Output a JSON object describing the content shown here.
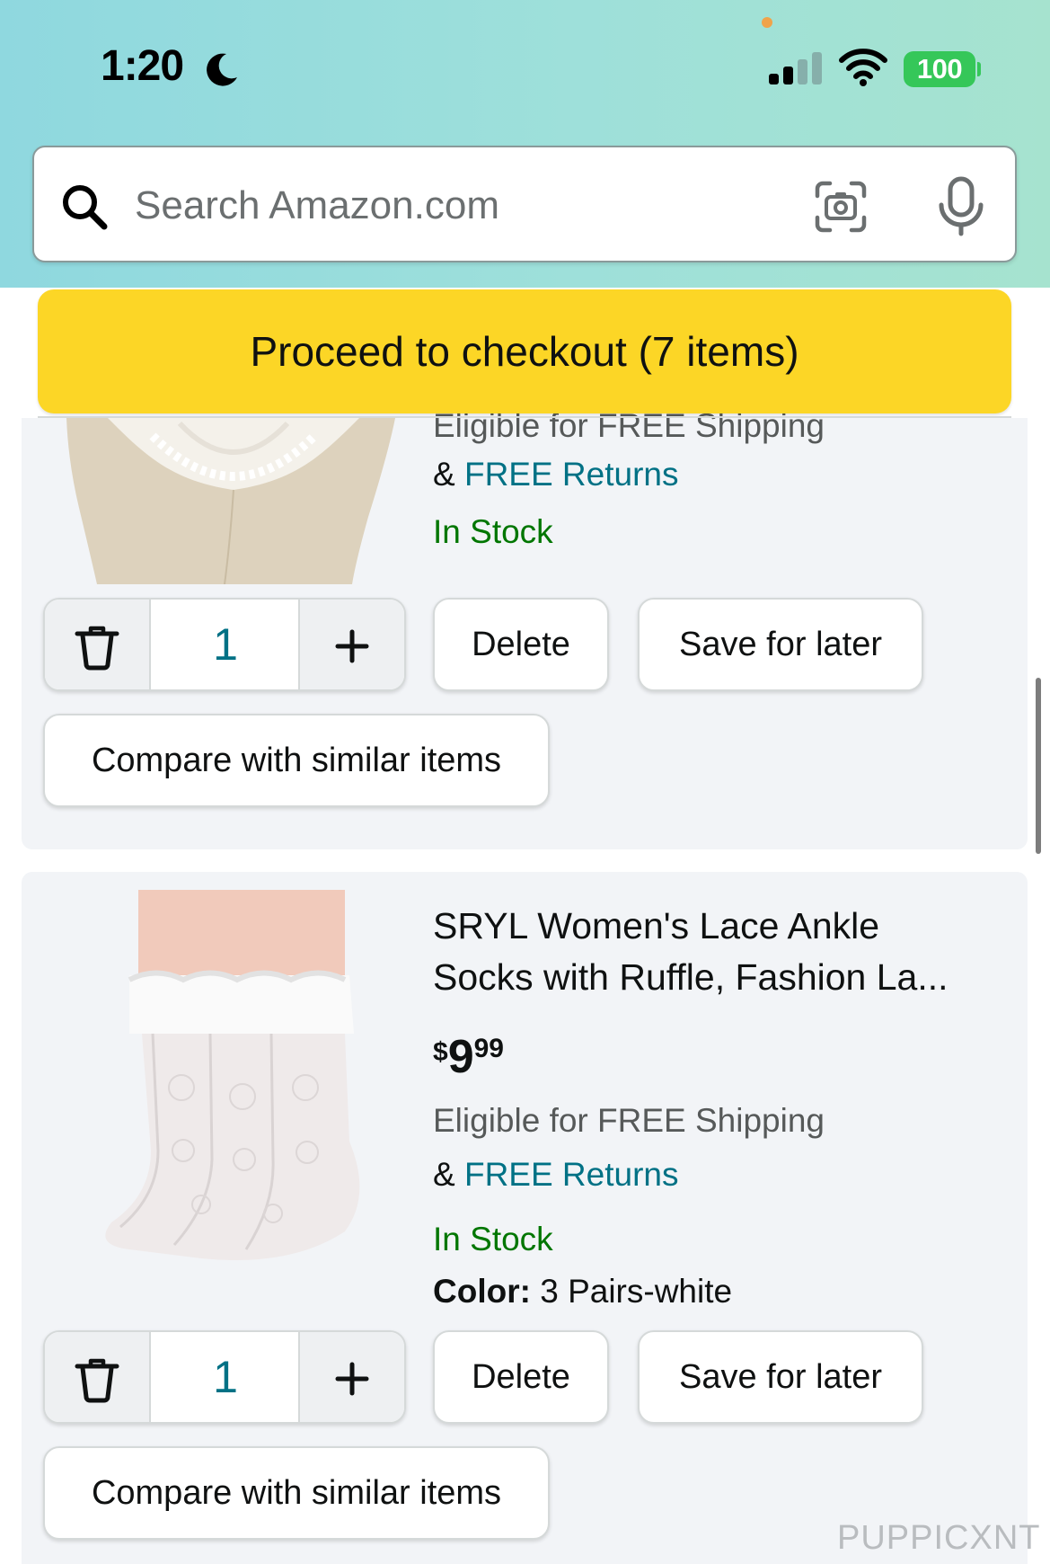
{
  "status_bar": {
    "time": "1:20",
    "battery": "100",
    "icons": [
      "moon-icon",
      "signal-icon",
      "wifi-icon",
      "battery-icon"
    ]
  },
  "search": {
    "placeholder": "Search Amazon.com",
    "value": "",
    "icons": [
      "search-icon",
      "camera-icon",
      "mic-icon"
    ]
  },
  "checkout": {
    "label": "Proceed to checkout (7 items)"
  },
  "items": [
    {
      "shipping": "Eligible for FREE Shipping",
      "returns_prefix": "&",
      "returns_link": "FREE Returns",
      "stock": "In Stock",
      "quantity": "1",
      "delete_label": "Delete",
      "save_label": "Save for later",
      "compare_label": "Compare with similar items"
    },
    {
      "title_line1": "SRYL Women's Lace Ankle",
      "title_line2": "Socks with Ruffle, Fashion La...",
      "price_symbol": "$",
      "price_whole": "9",
      "price_fraction": "99",
      "shipping": "Eligible for FREE Shipping",
      "returns_prefix": "&",
      "returns_link": "FREE Returns",
      "stock": "In Stock",
      "color_label": "Color:",
      "color_value": "3 Pairs-white",
      "quantity": "1",
      "delete_label": "Delete",
      "save_label": "Save for later",
      "compare_label": "Compare with similar items"
    }
  ],
  "watermark": "PUPPICXNT",
  "colors": {
    "checkout_yellow": "#fcd626",
    "link_teal": "#007185",
    "stock_green": "#007600",
    "battery_green": "#35c759",
    "card_bg": "#f2f4f7"
  }
}
